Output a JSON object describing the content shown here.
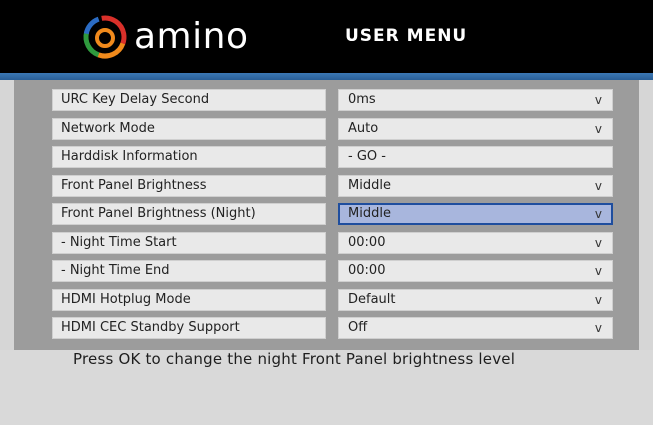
{
  "header": {
    "logo_text": "amino",
    "title": "USER MENU"
  },
  "menu": {
    "rows": [
      {
        "label": "URC Key Delay Second",
        "value": "0ms",
        "arrow": "v"
      },
      {
        "label": "Network Mode",
        "value": "Auto",
        "arrow": "v"
      },
      {
        "label": "Harddisk Information",
        "value": "- GO -",
        "arrow": ""
      },
      {
        "label": "Front Panel Brightness",
        "value": "Middle",
        "arrow": "v"
      },
      {
        "label": "Front Panel Brightness (Night)",
        "value": "Middle",
        "arrow": "v"
      },
      {
        "label": "- Night Time Start",
        "value": "00:00",
        "arrow": "v"
      },
      {
        "label": "- Night Time End",
        "value": "00:00",
        "arrow": "v"
      },
      {
        "label": "HDMI Hotplug Mode",
        "value": "Default",
        "arrow": "v"
      },
      {
        "label": "HDMI CEC Standby Support",
        "value": "Off",
        "arrow": "v"
      }
    ],
    "selected_index": 4
  },
  "help_text": "Press OK to change the night Front Panel brightness level",
  "colors": {
    "header_bg": "#000000",
    "stripe": "#3b78b5",
    "selected_bg": "#a8b6dd",
    "selected_border": "#1f4e9e"
  }
}
